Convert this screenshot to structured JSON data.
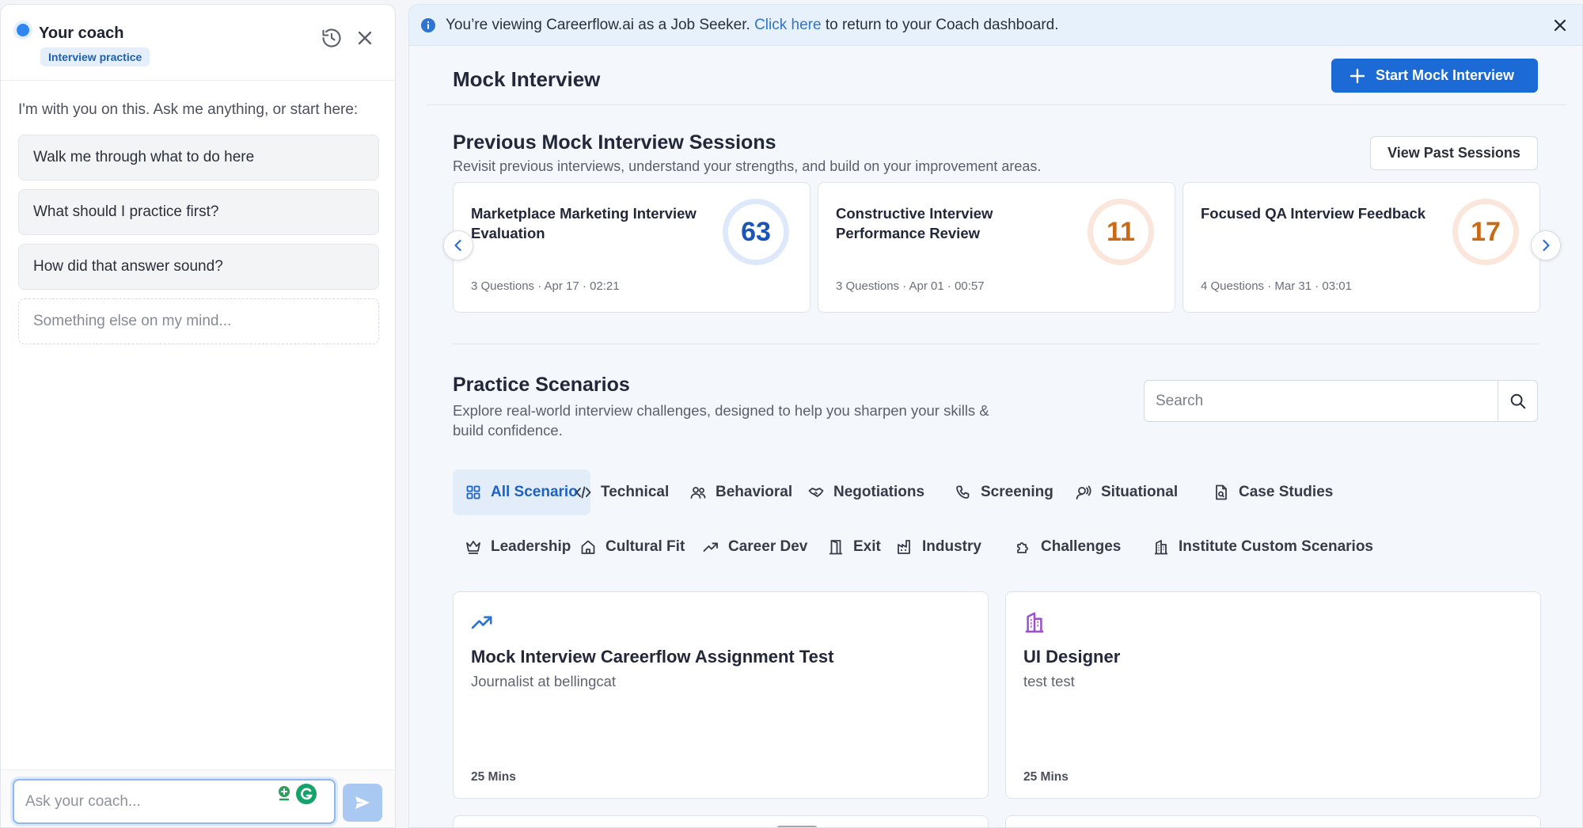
{
  "coach": {
    "title": "Your coach",
    "badge": "Interview practice",
    "intro": "I'm with you on this. Ask me anything, or start here:",
    "suggestions": [
      "Walk me through what to do here",
      "What should I practice first?",
      "How did that answer sound?"
    ],
    "other": "Something else on my mind...",
    "input_placeholder": "Ask your coach..."
  },
  "banner": {
    "prefix": "You’re viewing Careerflow.ai as a Job Seeker.",
    "link": "Click here",
    "suffix": "to return to your Coach dashboard."
  },
  "page": {
    "title": "Mock Interview",
    "start_button": "Start Mock Interview"
  },
  "previous": {
    "title": "Previous Mock Interview Sessions",
    "subtitle": "Revisit previous interviews, understand your strengths, and build on your improvement areas.",
    "view_button": "View Past Sessions",
    "sessions": [
      {
        "title": "Marketplace Marketing Interview Evaluation",
        "meta": "3 Questions · Apr 17 · 02:21",
        "score": "63",
        "score_color": "#1a56b8"
      },
      {
        "title": "Constructive Interview Performance Review",
        "meta": "3 Questions · Apr 01 · 00:57",
        "score": "11",
        "score_color": "#c96a16"
      },
      {
        "title": "Focused QA Interview Feedback",
        "meta": "4 Questions · Mar 31 · 03:01",
        "score": "17",
        "score_color": "#c96a16"
      }
    ]
  },
  "practice": {
    "title": "Practice Scenarios",
    "subtitle": "Explore real-world interview challenges, designed to help you sharpen your skills & build confidence.",
    "search_placeholder": "Search",
    "tabs": [
      {
        "label": "All Scenario",
        "icon": "grid-icon"
      },
      {
        "label": "Technical",
        "icon": "code-icon"
      },
      {
        "label": "Behavioral",
        "icon": "people-icon"
      },
      {
        "label": "Negotiations",
        "icon": "handshake-icon"
      },
      {
        "label": "Screening",
        "icon": "phone-icon"
      },
      {
        "label": "Situational",
        "icon": "user-chat-icon"
      },
      {
        "label": "Case Studies",
        "icon": "document-icon"
      },
      {
        "label": "Leadership",
        "icon": "crown-icon"
      },
      {
        "label": "Cultural Fit",
        "icon": "home-icon"
      },
      {
        "label": "Career Dev",
        "icon": "trending-up-icon"
      },
      {
        "label": "Exit",
        "icon": "door-icon"
      },
      {
        "label": "Industry",
        "icon": "factory-icon"
      },
      {
        "label": "Challenges",
        "icon": "puzzle-icon"
      },
      {
        "label": "Institute Custom Scenarios",
        "icon": "building-icon"
      }
    ],
    "scenarios": [
      {
        "title": "Mock Interview Careerflow Assignment Test",
        "subtitle": "Journalist at bellingcat",
        "duration": "25 Mins",
        "icon": "trending-up-icon",
        "icon_color": "#2f74d0"
      },
      {
        "title": "UI Designer",
        "subtitle": "test test",
        "duration": "25 Mins",
        "icon": "building-icon",
        "icon_color": "#9b4fd1"
      }
    ]
  },
  "colors": {
    "accent": "#1c6ad6",
    "banner_bg": "#e7f1fb",
    "active_tab_bg": "#e3edf9"
  }
}
